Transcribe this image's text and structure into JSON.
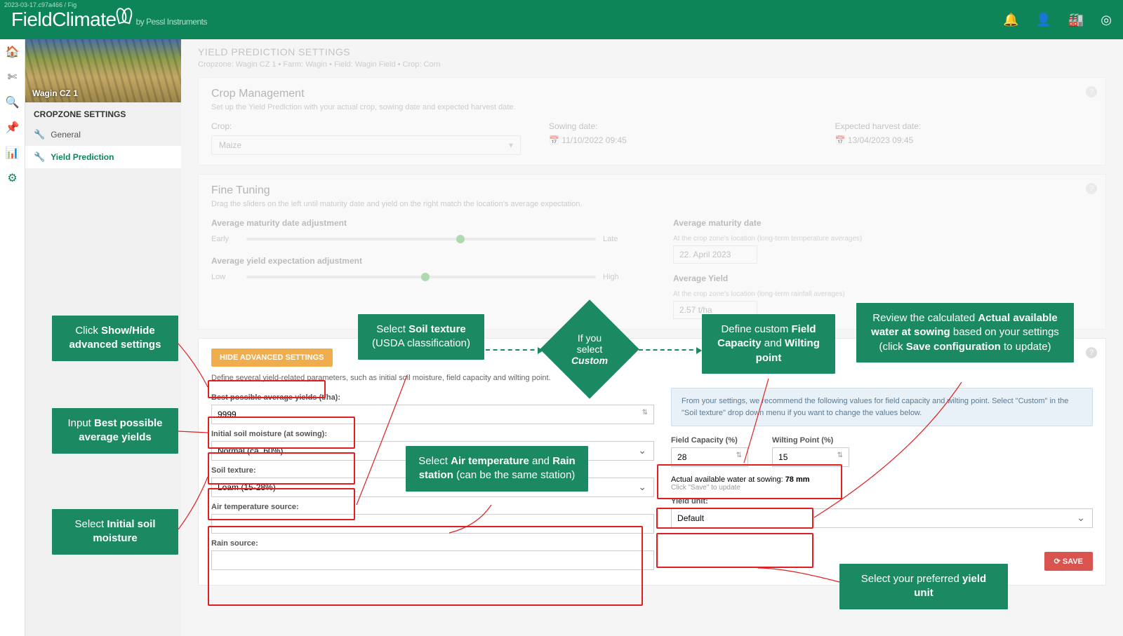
{
  "version_tag": "2023-03-17.c97a466 / Fig",
  "brand": {
    "name": "FieldClimate",
    "by": "by Pessl Instruments"
  },
  "cropzone_img_label": "Wagin CZ 1",
  "sidebar": {
    "title": "CROPZONE SETTINGS",
    "items": [
      {
        "label": "General"
      },
      {
        "label": "Yield Prediction"
      }
    ]
  },
  "page": {
    "title": "YIELD PREDICTION SETTINGS",
    "breadcrumb": "Cropzone: Wagin CZ 1 • Farm: Wagin • Field: Wagin Field • Crop: Corn"
  },
  "crop_mgmt": {
    "heading": "Crop Management",
    "sub": "Set up the Yield Prediction with your actual crop, sowing date and expected harvest date.",
    "crop_label": "Crop:",
    "crop_value": "Maize",
    "sowing_label": "Sowing date:",
    "sowing_value": "11/10/2022 09:45",
    "harvest_label": "Expected harvest date:",
    "harvest_value": "13/04/2023 09:45"
  },
  "fine": {
    "heading": "Fine Tuning",
    "sub": "Drag the sliders on the left until maturity date and yield on the right match the location's average expectation.",
    "mat_adj": "Average maturity date adjustment",
    "early": "Early",
    "late": "Late",
    "yield_adj": "Average yield expectation adjustment",
    "low": "Low",
    "high": "High",
    "mat_lbl": "Average maturity date",
    "mat_hint": "At the crop zone's location (long-term temperature averages)",
    "mat_val": "22. April 2023",
    "yld_lbl": "Average Yield",
    "yld_hint": "At the crop zone's location (long-term rainfall averages)",
    "yld_val": "2.57 t/ha"
  },
  "adv": {
    "btn": "HIDE ADVANCED SETTINGS",
    "desc": "Define several yield-related parameters, such as initial soil moisture, field capacity and wilting point.",
    "bpy_label": "Best possible average yields (t/ha):",
    "bpy_value": "9999",
    "ism_label": "Initial soil moisture (at sowing):",
    "ism_value": "Normal (ca. 60%)",
    "st_label": "Soil texture:",
    "st_value": "Loam (15-28%)",
    "air_label": "Air temperature source:",
    "air_value": "",
    "rain_label": "Rain source:",
    "rain_value": "",
    "info": "From your settings, we recommend the following values for field capacity and wilting point. Select \"Custom\" in the \"Soil texture\" drop down menu if you want to change the values below.",
    "fc_label": "Field Capacity (%)",
    "fc_value": "28",
    "wp_label": "Wilting Point (%)",
    "wp_value": "15",
    "aaw_label": "Actual available water at sowing:",
    "aaw_value": "78 mm",
    "aaw_hint": "Click \"Save\" to update",
    "yu_label": "Yield unit:",
    "yu_value": "Default",
    "save": "SAVE"
  },
  "ann": {
    "a1_pre": "Click ",
    "a1_b": "Show/Hide advanced settings",
    "a2_pre": "Input ",
    "a2_b": "Best possible average yields",
    "a3_pre": "Select ",
    "a3_b": "Initial soil moisture",
    "a4_pre": "Select ",
    "a4_b": "Soil texture",
    "a4_post": " (USDA classification)",
    "a5_pre": "If you",
    "a5_mid": "select",
    "a5_b": "Custom",
    "a6_pre": "Define custom ",
    "a6_b1": "Field Capacity",
    "a6_mid": " and ",
    "a6_b2": "Wilting point",
    "a7_pre": "Review the calculated ",
    "a7_b1": "Actual available water at sowing",
    "a7_mid": " based on your settings (click ",
    "a7_b2": "Save configuration",
    "a7_post": " to update)",
    "a8_pre": "Select ",
    "a8_b1": "Air temperature",
    "a8_mid": " and ",
    "a8_b2": "Rain station",
    "a8_post": " (can be the same station)",
    "a9_pre": "Select your preferred ",
    "a9_b": "yield unit"
  }
}
